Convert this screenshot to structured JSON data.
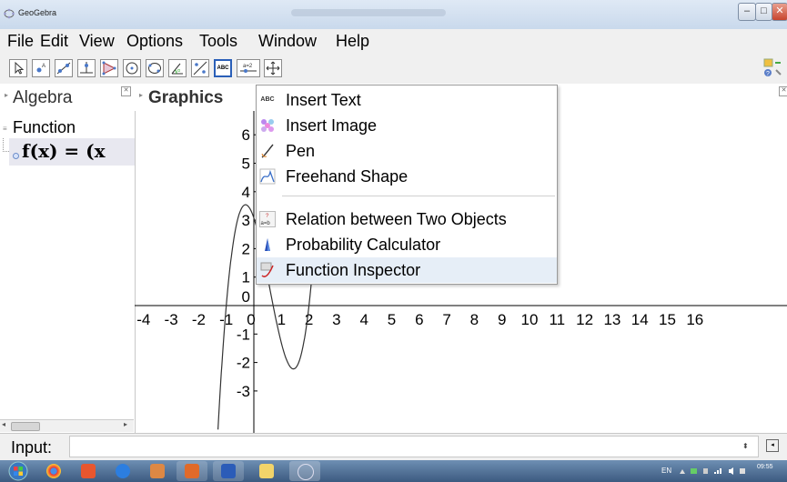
{
  "window": {
    "title": "GeoGebra",
    "buttons": {
      "minimize": "–",
      "maximize": "□",
      "close": "✕"
    }
  },
  "menubar": [
    "File",
    "Edit",
    "View",
    "Options",
    "Tools",
    "Window",
    "Help"
  ],
  "toolbar": {
    "tools": [
      "move-tool",
      "point-tool",
      "line-tool",
      "perpendicular-tool",
      "polygon-tool",
      "circle-tool",
      "conic-tool",
      "angle-tool",
      "reflect-tool",
      "insert-text-tool",
      "slider-tool",
      "move-graphics-tool"
    ],
    "active_tool": "insert-text-tool",
    "insert_text_icon": "ABC",
    "slider_icon": "a=2"
  },
  "algebra": {
    "title": "Algebra",
    "category": "Function",
    "function_expr": "f(x) = (x"
  },
  "graphics": {
    "title": "Graphics",
    "x_ticks": [
      "-4",
      "-3",
      "-2",
      "-1",
      "0",
      "1",
      "2",
      "3",
      "4",
      "5",
      "6",
      "7",
      "8",
      "9",
      "10",
      "11",
      "12",
      "13",
      "14",
      "15",
      "16"
    ],
    "y_ticks": [
      "6",
      "5",
      "4",
      "3",
      "2",
      "1",
      "0",
      "-1",
      "-2",
      "-3"
    ]
  },
  "context_menu": {
    "items": [
      {
        "label": "Insert Text",
        "icon": "abc-text-icon"
      },
      {
        "label": "Insert Image",
        "icon": "image-icon"
      },
      {
        "label": "Pen",
        "icon": "pen-icon"
      },
      {
        "label": "Freehand Shape",
        "icon": "freehand-icon"
      },
      {
        "label": "Relation between Two Objects",
        "icon": "relation-icon"
      },
      {
        "label": "Probability Calculator",
        "icon": "probability-icon"
      },
      {
        "label": "Function Inspector",
        "icon": "function-inspector-icon"
      }
    ],
    "highlighted": "Function Inspector"
  },
  "inputbar": {
    "label": "Input:",
    "value": ""
  },
  "taskbar": {
    "apps": [
      "chrome-icon",
      "office-icon",
      "ie-icon",
      "paint-icon",
      "powerpoint-icon",
      "word-icon",
      "explorer-icon",
      "geogebra-icon"
    ],
    "tray_lang": "EN",
    "clock_time": "09:55"
  },
  "colors": {
    "accent": "#2a5fb8",
    "highlight": "#e6eef7",
    "taskbar": "#4a6a90"
  }
}
